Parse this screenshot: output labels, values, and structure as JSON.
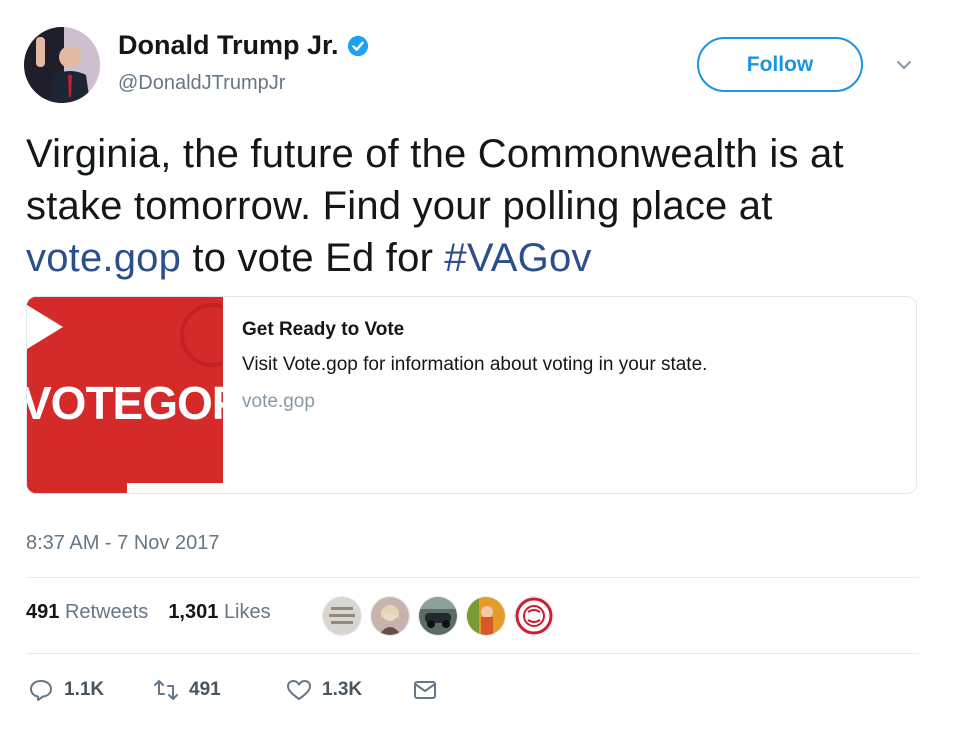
{
  "author": {
    "display_name": "Donald Trump Jr.",
    "handle": "@DonaldJTrumpJr",
    "verified": true
  },
  "follow_label": "Follow",
  "tweet": {
    "text_before_link": "Virginia, the future of the Commonwealth is at stake tomorrow. Find your polling place at ",
    "link_text": "vote.gop",
    "text_middle": " to vote Ed for ",
    "hashtag": "#VAGov"
  },
  "card": {
    "image_text": "VOTEGOP",
    "title": "Get Ready to Vote",
    "description": "Visit Vote.gop for information about voting in your state.",
    "domain": "vote.gop"
  },
  "timestamp": "8:37 AM - 7 Nov 2017",
  "stats": {
    "retweets_count": "491",
    "retweets_label": "Retweets",
    "likes_count": "1,301",
    "likes_label": "Likes"
  },
  "actions": {
    "replies": "1.1K",
    "retweets": "491",
    "likes": "1.3K"
  },
  "colors": {
    "link": "#2b4f8c",
    "follow_blue": "#1b95e0",
    "card_red": "#d42a2a",
    "muted": "#657786"
  },
  "icons": {
    "verified": "verified-badge-icon",
    "caret": "chevron-down-icon",
    "reply": "reply-icon",
    "retweet": "retweet-icon",
    "like": "heart-icon",
    "dm": "envelope-icon"
  }
}
